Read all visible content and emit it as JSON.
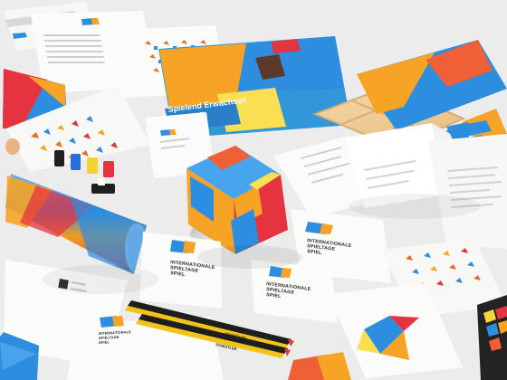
{
  "scene": {
    "brand": {
      "line1": "INTERNATIONALE",
      "line2": "SPIELTAGE",
      "line3": "SPIEL"
    },
    "poster": {
      "title_line1": "Spielend Erwachsen",
      "title_line2": "für 2017"
    },
    "pencils": {
      "brand": "STAEDTLER"
    },
    "colors": {
      "background": "#ececec",
      "blue": "#2d8ee0",
      "orange": "#f7a325",
      "red": "#e5343f",
      "yellow": "#f5d83a",
      "paper": "#f7f7f5"
    }
  }
}
